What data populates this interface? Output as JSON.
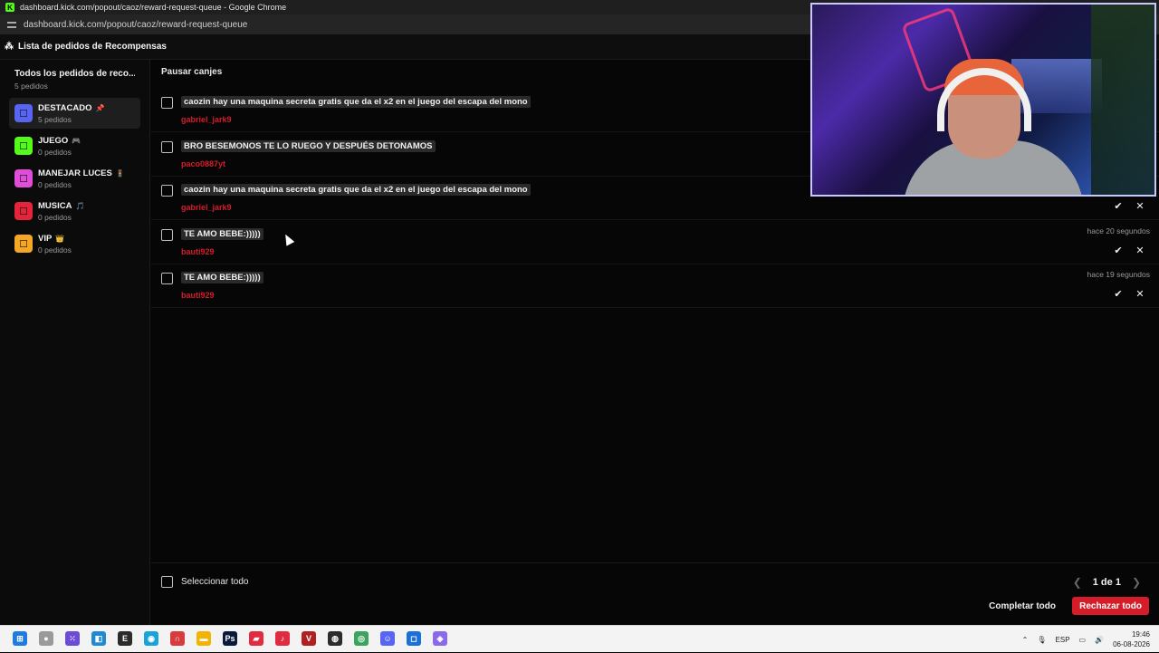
{
  "browser": {
    "window_title": "dashboard.kick.com/popout/caoz/reward-request-queue - Google Chrome",
    "url": "dashboard.kick.com/popout/caoz/reward-request-queue"
  },
  "app": {
    "header_title": "Lista de pedidos de Recompensas"
  },
  "sidebar": {
    "all_title": "Todos los pedidos de reco...",
    "all_count": "5 pedidos",
    "items": [
      {
        "name": "DESTACADO",
        "emoji": "📌",
        "count": "5 pedidos",
        "color": "#5865f2",
        "icon": "ticket-icon",
        "active": true
      },
      {
        "name": "JUEGO",
        "emoji": "🎮",
        "count": "0 pedidos",
        "color": "#53fc18",
        "icon": "ticket-icon",
        "active": false
      },
      {
        "name": "MANEJAR LUCES",
        "emoji": "🚦",
        "count": "0 pedidos",
        "color": "#e04dd8",
        "icon": "ticket-icon",
        "active": false
      },
      {
        "name": "MUSICA",
        "emoji": "🎵",
        "count": "0 pedidos",
        "color": "#e3243b",
        "icon": "ticket-icon",
        "active": false
      },
      {
        "name": "VIP",
        "emoji": "👑",
        "count": "0 pedidos",
        "color": "#f5a623",
        "icon": "ticket-icon",
        "active": false
      }
    ]
  },
  "main": {
    "pause_label": "Pausar canjes",
    "requests": [
      {
        "message": "caozin hay una maquina secreta gratis que da el x2 en el juego del escapa del mono",
        "user": "gabriel_jark9",
        "time": ""
      },
      {
        "message": "BRO BESEMONOS TE LO RUEGO Y DESPUÉS DETONAMOS",
        "user": "paco0887yt",
        "time": ""
      },
      {
        "message": "caozin hay una maquina secreta gratis que da el x2 en el juego del escapa del mono",
        "user": "gabriel_jark9",
        "time": ""
      },
      {
        "message": "TE AMO BEBE:)))))",
        "user": "bauti929",
        "time": "hace 20 segundos"
      },
      {
        "message": "TE AMO BEBE:)))))",
        "user": "bauti929",
        "time": "hace 19 segundos"
      }
    ],
    "select_all_label": "Seleccionar todo",
    "pager": {
      "text": "1 de 1"
    },
    "complete_all_label": "Completar todo",
    "reject_all_label": "Rechazar todo",
    "colors": {
      "accent_red": "#d51d2a",
      "kick_green": "#53fc18"
    }
  },
  "taskbar": {
    "lang": "ESP",
    "time": "19:46",
    "date": "06-08-2026"
  }
}
